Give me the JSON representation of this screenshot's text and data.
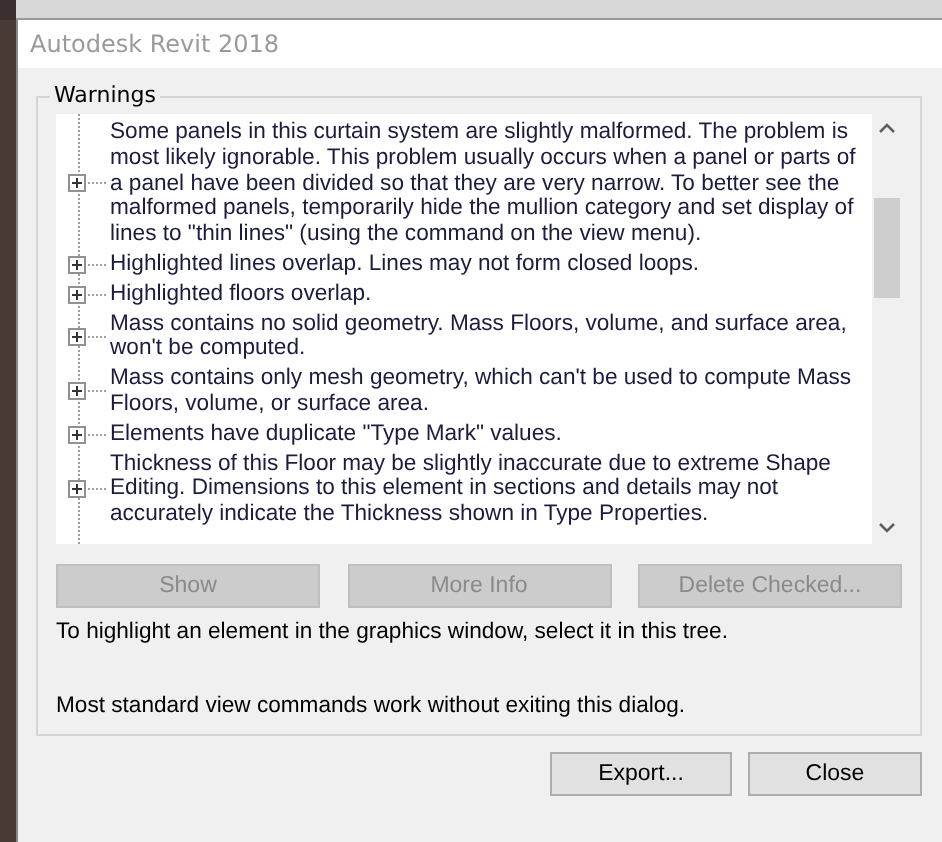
{
  "window": {
    "title": "Autodesk Revit 2018"
  },
  "group": {
    "label": "Warnings"
  },
  "warnings": [
    {
      "text": "Some panels in this curtain system are slightly malformed.  The problem is most likely ignorable. This problem usually occurs when a panel or parts of a panel have been divided so that they are very narrow.  To better see the malformed panels, temporarily hide the mullion category and set display of lines to \"thin lines\" (using the command on the view menu).",
      "expanded": false
    },
    {
      "text": "Highlighted lines overlap. Lines may not form closed loops.",
      "expanded": false
    },
    {
      "text": "Highlighted floors overlap.",
      "expanded": false
    },
    {
      "text": "Mass contains no solid geometry. Mass Floors, volume, and surface area, won't be computed.",
      "expanded": false
    },
    {
      "text": "Mass contains only mesh geometry, which can't be used to compute Mass Floors, volume, or surface area.",
      "expanded": false
    },
    {
      "text": "Elements have duplicate \"Type Mark\" values.",
      "expanded": false
    },
    {
      "text": "Thickness of this Floor may be slightly inaccurate due to extreme Shape Editing. Dimensions to this element in sections and details may not accurately indicate the Thickness shown in Type Properties.",
      "expanded": false
    }
  ],
  "actions": [
    {
      "label": "Show",
      "disabled": true
    },
    {
      "label": "More Info",
      "disabled": true
    },
    {
      "label": "Delete Checked...",
      "disabled": true
    }
  ],
  "hints": [
    "To highlight an element in the graphics window, select it in this tree.",
    "Most standard view commands work without exiting this dialog."
  ],
  "buttons": [
    {
      "label": "Export..."
    },
    {
      "label": "Close"
    }
  ]
}
